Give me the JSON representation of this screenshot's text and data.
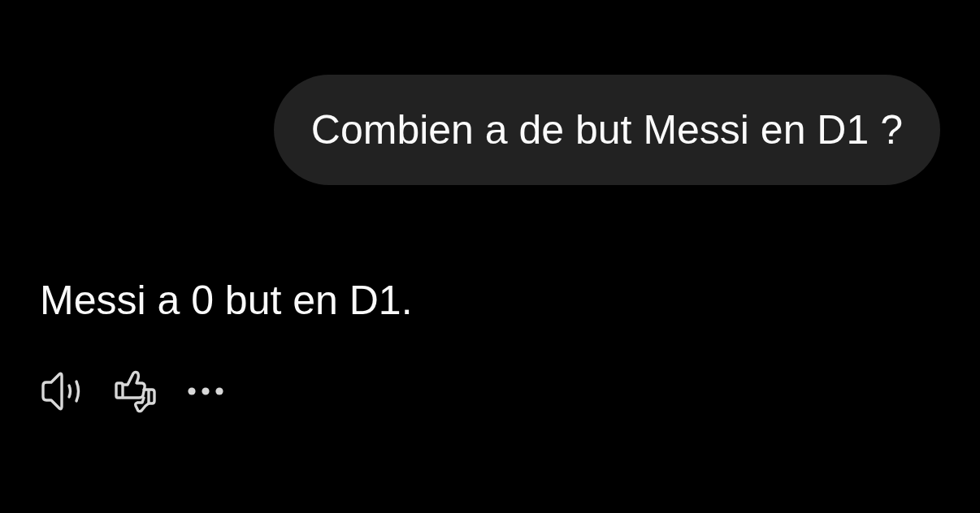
{
  "messages": [
    {
      "kind": "user",
      "text": "Combien a de but Messi en D1 ?"
    },
    {
      "kind": "assistant",
      "text": "Messi a 0 but en D1."
    }
  ]
}
